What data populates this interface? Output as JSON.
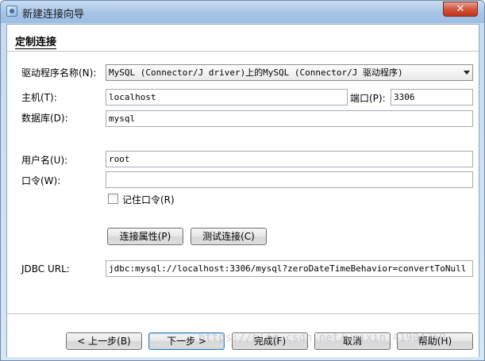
{
  "window": {
    "title": "新建连接向导",
    "close_glyph": "✕"
  },
  "header": {
    "section_title": "定制连接"
  },
  "form": {
    "driver_label": "驱动程序名称(N):",
    "driver_value": "MySQL (Connector/J driver)上的MySQL (Connector/J 驱动程序)",
    "host_label": "主机(T):",
    "host_value": "localhost",
    "port_label": "端口(P):",
    "port_value": "3306",
    "database_label": "数据库(D):",
    "database_value": "mysql",
    "username_label": "用户名(U):",
    "username_value": "root",
    "password_label": "口令(W):",
    "password_value": "",
    "remember_label": "记住口令(R)",
    "remember_checked": false,
    "conn_props_button": "连接属性(P)",
    "test_conn_button": "测试连接(C)",
    "jdbc_label": "JDBC URL:",
    "jdbc_value": "jdbc:mysql://localhost:3306/mysql?zeroDateTimeBehavior=convertToNull"
  },
  "footer": {
    "back_button": "< 上一步(B)",
    "next_button": "下一步 >",
    "finish_button": "完成(F)",
    "cancel_button": "取消",
    "help_button": "帮助(H)"
  },
  "watermark": "https://blog.csdn.net/weixin_41904350"
}
